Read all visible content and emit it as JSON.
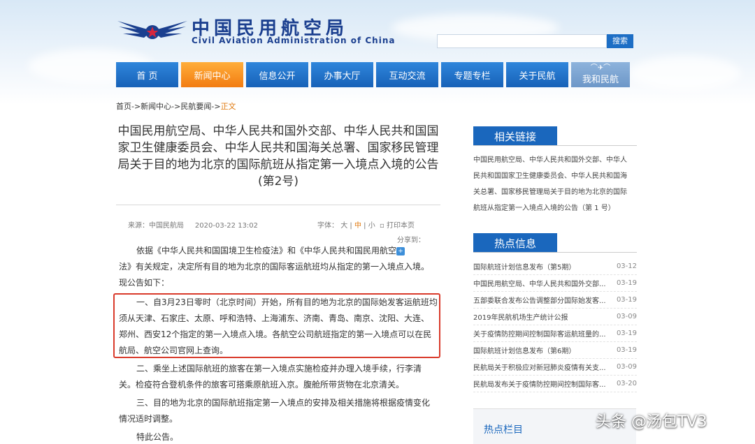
{
  "header": {
    "logo_cn": "中国民用航空局",
    "logo_en": "Civil Aviation Administration of China",
    "search_placeholder": "",
    "search_label": "搜索"
  },
  "nav": [
    {
      "label": "首 页"
    },
    {
      "label": "新闻中心"
    },
    {
      "label": "信息公开"
    },
    {
      "label": "办事大厅"
    },
    {
      "label": "互动交流"
    },
    {
      "label": "专题专栏"
    },
    {
      "label": "关于民航"
    },
    {
      "label": "我和民航"
    }
  ],
  "breadcrumb": {
    "path": "首页->新闻中心->民航要闻->",
    "current": "正文"
  },
  "article": {
    "title": "中国民用航空局、中华人民共和国外交部、中华人民共和国国家卫生健康委员会、中华人民共和国海关总署、国家移民管理局关于目的地为北京的国际航班从指定第一入境点入境的公告(第2号)",
    "source": "来源：中国民航局",
    "date": "2020-03-22 13:02",
    "font_label": "字体：",
    "font_large": "大",
    "font_mid": "中",
    "font_small": "小",
    "sep": "|",
    "print": "打印本页",
    "share": "分享到：",
    "p1_line1": "依据《中华人民共和国国境卫生检疫法》和《中华人民共和国民用航空",
    "p1_line2": "法》有关规定，决定所有目的地为北京的国际客运航班均从指定的第一入境点入境。",
    "p1_line3": "现公告如下：",
    "p2_line1": "一、自3月23日零时（北京时间）开始，所有目的地为北京的国际始发客运航班均",
    "p2_line2": "须从天津、石家庄、太原、呼和浩特、上海浦东、济南、青岛、南京、沈阳、大连、",
    "p2_line3": "郑州、西安12个指定的第一入境点入境。各航空公司航班指定的第一入境点可以在民",
    "p2_line4": "航局、航空公司官网上查询。",
    "p3_line1": "二、乘坐上述国际航班的旅客在第一入境点实施检疫并办理入境手续，行李清",
    "p3_line2": "关。检疫符合登机条件的旅客可搭乘原航班入京。腹舱所带货物在北京清关。",
    "p4_line1": "三、目的地为北京的国际航班指定第一入境点的安排及相关措施将根据疫情变化",
    "p4_line2": "情况适时调整。",
    "p5": "特此公告。"
  },
  "sidebar": {
    "related_title": "相关链接",
    "related_lines": [
      "中国民用航空局、中华人民共和国外交部、中华人",
      "民共和国国家卫生健康委员会、中华人民共和国海",
      "关总署、国家移民管理局关于目的地为北京的国际",
      "航班从指定第一入境点入境的公告（第 1 号）"
    ],
    "hot_title": "热点信息",
    "hot_items": [
      {
        "title": "国际航班计划信息发布（第5期）",
        "date": "03-12"
      },
      {
        "title": "中国民用航空局、中华人民共和国外交部...",
        "date": "03-19"
      },
      {
        "title": "五部委联合发布公告调整部分国际始发客...",
        "date": "03-19"
      },
      {
        "title": "2019年民航机场生产统计公报",
        "date": "03-09"
      },
      {
        "title": "关于疫情防控期间控制国际客运航班量的...",
        "date": "03-19"
      },
      {
        "title": "国际航班计划信息发布（第6期）",
        "date": "03-19"
      },
      {
        "title": "民航局关于积极应对新冠肺炎疫情有关支...",
        "date": "03-09"
      },
      {
        "title": "民航局发布关于疫情防控期间控制国际客...",
        "date": "03-20"
      }
    ],
    "hot_column_title": "热点栏目"
  },
  "watermark": "头条 @汤包TV3",
  "colors": {
    "nav_blue": "#1762b8",
    "nav_active": "#f27c12",
    "highlight_box": "#d93a2b",
    "brand": "#1b3f8f"
  }
}
